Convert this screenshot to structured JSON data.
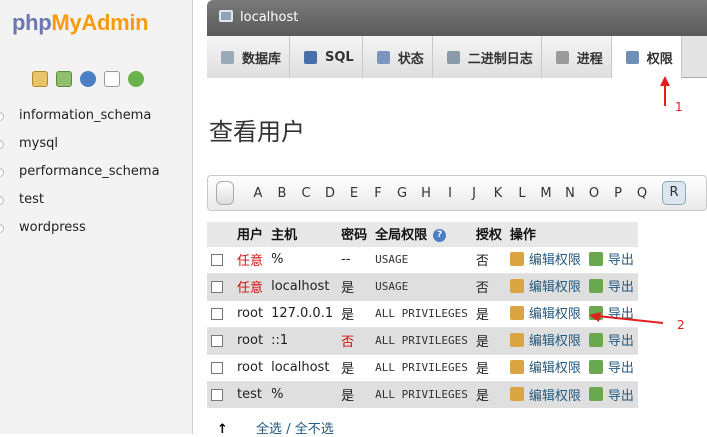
{
  "sidebar": {
    "logo_part1": "php",
    "logo_part2": "MyAdmin",
    "databases": [
      "information_schema",
      "mysql",
      "performance_schema",
      "test",
      "wordpress"
    ]
  },
  "topbar": {
    "server": "localhost"
  },
  "tabs": [
    {
      "label": "数据库",
      "icon": "database-icon"
    },
    {
      "label": "SQL",
      "icon": "sql-icon"
    },
    {
      "label": "状态",
      "icon": "status-icon"
    },
    {
      "label": "二进制日志",
      "icon": "binlog-icon"
    },
    {
      "label": "进程",
      "icon": "gear-icon"
    },
    {
      "label": "权限",
      "icon": "privileges-icon",
      "active": true
    }
  ],
  "page_title": "查看用户",
  "letters": [
    "A",
    "B",
    "C",
    "D",
    "E",
    "F",
    "G",
    "H",
    "I",
    "J",
    "K",
    "L",
    "M",
    "N",
    "O",
    "P",
    "Q",
    "R"
  ],
  "table": {
    "headers": {
      "user": "用户",
      "host": "主机",
      "password": "密码",
      "global": "全局权限",
      "grant": "授权",
      "action": "操作"
    },
    "rows": [
      {
        "user": "任意",
        "user_red": true,
        "host": "%",
        "password": "--",
        "pw_red": false,
        "global": "USAGE",
        "grant": "否"
      },
      {
        "user": "任意",
        "user_red": true,
        "host": "localhost",
        "password": "是",
        "pw_red": false,
        "global": "USAGE",
        "grant": "否"
      },
      {
        "user": "root",
        "user_red": false,
        "host": "127.0.0.1",
        "password": "是",
        "pw_red": false,
        "global": "ALL PRIVILEGES",
        "grant": "是"
      },
      {
        "user": "root",
        "user_red": false,
        "host": "::1",
        "password": "否",
        "pw_red": true,
        "global": "ALL PRIVILEGES",
        "grant": "是"
      },
      {
        "user": "root",
        "user_red": false,
        "host": "localhost",
        "password": "是",
        "pw_red": false,
        "global": "ALL PRIVILEGES",
        "grant": "是"
      },
      {
        "user": "test",
        "user_red": false,
        "host": "%",
        "password": "是",
        "pw_red": false,
        "global": "ALL PRIVILEGES",
        "grant": "是"
      }
    ],
    "edit_label": "编辑权限",
    "export_label": "导出"
  },
  "footer": {
    "select_all": "全选",
    "separator": "/",
    "deselect_all": "全不选"
  },
  "annotations": {
    "label1": "1",
    "label2": "2",
    "color": "#e02020"
  }
}
